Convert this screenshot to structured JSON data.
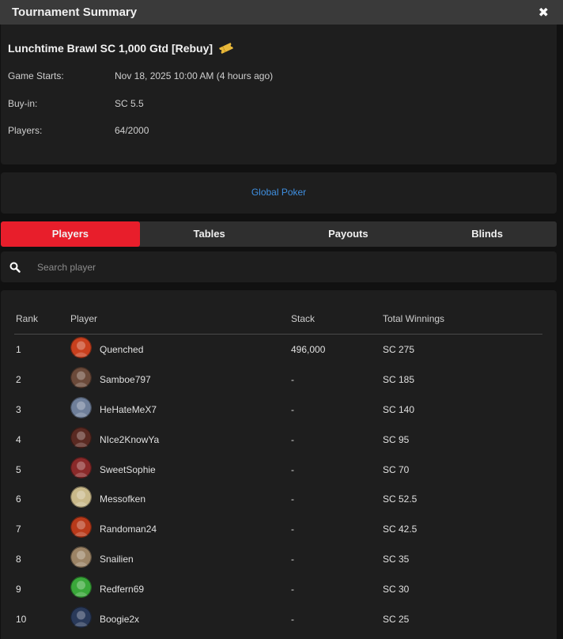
{
  "window": {
    "title": "Tournament Summary",
    "close_glyph": "✖"
  },
  "tournament": {
    "name": "Lunchtime Brawl SC 1,000 Gtd [Rebuy]",
    "ticket_icon": "ticket-icon",
    "details": [
      {
        "label": "Game Starts:",
        "value": "Nov 18, 2025 10:00 AM (4 hours ago)"
      },
      {
        "label": "Buy-in:",
        "value": "SC 5.5"
      },
      {
        "label": "Players:",
        "value": "64/2000"
      }
    ]
  },
  "network": {
    "link": "Global Poker"
  },
  "tabs": [
    {
      "label": "Players",
      "active": true
    },
    {
      "label": "Tables",
      "active": false
    },
    {
      "label": "Payouts",
      "active": false
    },
    {
      "label": "Blinds",
      "active": false
    }
  ],
  "search": {
    "placeholder": "Search player",
    "value": ""
  },
  "table": {
    "headers": {
      "rank": "Rank",
      "player": "Player",
      "stack": "Stack",
      "winnings": "Total Winnings"
    },
    "rows": [
      {
        "rank": "1",
        "player": "Quenched",
        "stack": "496,000",
        "winnings": "SC 275",
        "avatar_color": "#c8401e"
      },
      {
        "rank": "2",
        "player": "Samboe797",
        "stack": "-",
        "winnings": "SC 185",
        "avatar_color": "#6b4a3a"
      },
      {
        "rank": "3",
        "player": "HeHateMeX7",
        "stack": "-",
        "winnings": "SC 140",
        "avatar_color": "#6f7f9a"
      },
      {
        "rank": "4",
        "player": "NIce2KnowYa",
        "stack": "-",
        "winnings": "SC 95",
        "avatar_color": "#5a2a22"
      },
      {
        "rank": "5",
        "player": "SweetSophie",
        "stack": "-",
        "winnings": "SC 70",
        "avatar_color": "#8a2a2a"
      },
      {
        "rank": "6",
        "player": "Messofken",
        "stack": "-",
        "winnings": "SC 52.5",
        "avatar_color": "#c9b98a"
      },
      {
        "rank": "7",
        "player": "Randoman24",
        "stack": "-",
        "winnings": "SC 42.5",
        "avatar_color": "#b83a1a"
      },
      {
        "rank": "8",
        "player": "Snailien",
        "stack": "-",
        "winnings": "SC 35",
        "avatar_color": "#9c8466"
      },
      {
        "rank": "9",
        "player": "Redfern69",
        "stack": "-",
        "winnings": "SC 30",
        "avatar_color": "#3aa83a"
      },
      {
        "rank": "10",
        "player": "Boogie2x",
        "stack": "-",
        "winnings": "SC 25",
        "avatar_color": "#2a3a5a"
      }
    ]
  },
  "colors": {
    "accent": "#e81e2b",
    "link": "#3f8fe0",
    "ticket": "#e8b83a"
  }
}
